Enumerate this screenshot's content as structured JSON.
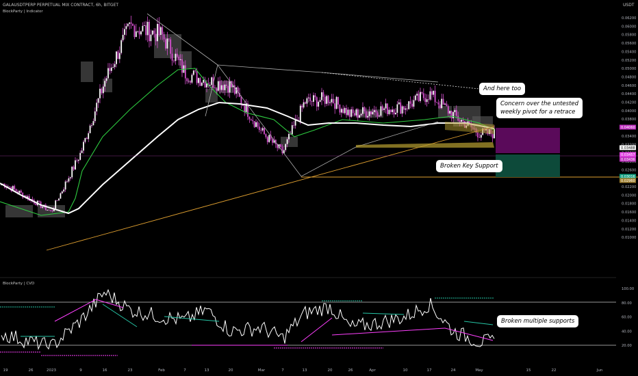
{
  "header": {
    "symbol": "GALAUSDTPERP PERPETUAL MIX CONTRACT, 6h, BITGET",
    "indicator": "BlockParty | Indicator",
    "pane2_title": "BlockParty | CVD",
    "currency": "USDT"
  },
  "annotations": {
    "here_too": "And here too",
    "concern_line1": "Concern over the untested",
    "concern_line2": "weekly pivot for a retrace",
    "broken_key": "Broken Key Support",
    "broken_multi": "Broken multiple supports"
  },
  "price_tags": {
    "tag_purple_top": "0.04060",
    "tag_white": "0.03488",
    "tag_magenta_1": "0.03457",
    "tag_magenta_2": "0.03436",
    "tag_green": "0.03016",
    "tag_tan": "0.02960"
  },
  "colors": {
    "background": "#000000",
    "candle_wick": "#d64fcf",
    "green_line": "#2ecc40",
    "white_line": "#ffffff",
    "gray_line": "#b0b0b0",
    "orange_line": "#e0a030",
    "support_band": "#b8a030",
    "short_box_red": "#5a0a5a",
    "short_box_green": "#0d4a3a",
    "cvd_line": "#ffffff",
    "cvd_magenta": "#ff40ff",
    "cvd_teal": "#26c6a6"
  },
  "chart_data": [
    {
      "type": "line",
      "title": "GALAUSDTPERP PERPETUAL MIX CONTRACT, 6h, BITGET",
      "ylabel": "USDT",
      "y_ticks": [
        "0.06200",
        "0.06000",
        "0.05800",
        "0.05600",
        "0.05400",
        "0.05200",
        "0.05000",
        "0.04800",
        "0.04600",
        "0.04400",
        "0.04200",
        "0.04000",
        "0.03800",
        "0.03600",
        "0.03400",
        "0.03200",
        "0.03000",
        "0.02800",
        "0.02600",
        "0.02400",
        "0.02200",
        "0.02000",
        "0.01800",
        "0.01600",
        "0.01400",
        "0.01200",
        "0.01000"
      ],
      "x_ticks": [
        "19",
        "26",
        "2023",
        "9",
        "16",
        "23",
        "Feb",
        "7",
        "13",
        "20",
        "Mar",
        "7",
        "13",
        "20",
        "26",
        "Apr",
        "10",
        "17",
        "24",
        "May",
        "15",
        "22",
        "Jun"
      ],
      "ylim": [
        0.0095,
        0.0635
      ],
      "series": [
        {
          "x": [
            "19",
            "26",
            "2023",
            "9",
            "16",
            "23",
            "Feb",
            "7",
            "13",
            "20",
            "Mar",
            "7",
            "13",
            "20",
            "26",
            "Apr",
            "10",
            "17",
            "24",
            "May"
          ],
          "values": [
            0.0225,
            0.019,
            0.016,
            0.03,
            0.047,
            0.06,
            0.058,
            0.049,
            0.047,
            0.046,
            0.035,
            0.03,
            0.042,
            0.043,
            0.039,
            0.04,
            0.041,
            0.044,
            0.039,
            0.0346
          ]
        }
      ]
    },
    {
      "type": "line",
      "title": "BlockParty | CVD",
      "y_ticks": [
        "100.00",
        "80.00",
        "60.00",
        "40.00",
        "20.00"
      ],
      "ylim": [
        10,
        100
      ],
      "x_ticks": [
        "19",
        "26",
        "2023",
        "9",
        "16",
        "23",
        "Feb",
        "7",
        "13",
        "20",
        "Mar",
        "7",
        "13",
        "20",
        "26",
        "Apr",
        "10",
        "17",
        "24",
        "May",
        "15",
        "22",
        "Jun"
      ],
      "series": [
        {
          "x": [
            "19",
            "26",
            "2023",
            "9",
            "16",
            "23",
            "Feb",
            "7",
            "13",
            "20",
            "Mar",
            "7",
            "13",
            "20",
            "26",
            "Apr",
            "10",
            "17",
            "24",
            "May"
          ],
          "values": [
            35,
            25,
            18,
            55,
            95,
            70,
            60,
            55,
            70,
            40,
            45,
            30,
            65,
            75,
            45,
            50,
            60,
            78,
            40,
            25
          ]
        }
      ]
    }
  ]
}
